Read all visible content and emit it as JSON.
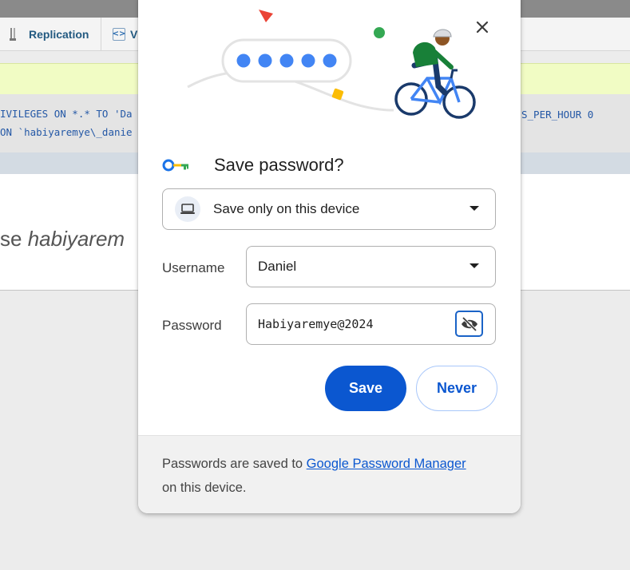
{
  "background": {
    "tabs": [
      {
        "label": "Replication",
        "icon": "replication-icon"
      },
      {
        "label": "V",
        "icon": "variables-icon"
      }
    ],
    "sql_lines": [
      "IVILEGES ON *.* TO 'Da",
      "ON `habiyaremye\\_danie"
    ],
    "sql_right": "S_PER_HOUR 0",
    "db_title_prefix": "se ",
    "db_title_name": "habiyarem"
  },
  "dialog": {
    "title": "Save password?",
    "close_icon": "close-icon",
    "save_location": "Save only on this device",
    "username_label": "Username",
    "username_value": "Daniel",
    "password_label": "Password",
    "password_value": "Habiyaremye@2024",
    "save_button": "Save",
    "never_button": "Never",
    "footer_prefix": "Passwords are saved to ",
    "footer_link": "Google Password Manager",
    "footer_suffix": "on this device.",
    "colors": {
      "primary": "#0b57d0",
      "key_blue": "#1a73e8",
      "key_orange": "#fbbc04",
      "key_green": "#34a853"
    }
  }
}
